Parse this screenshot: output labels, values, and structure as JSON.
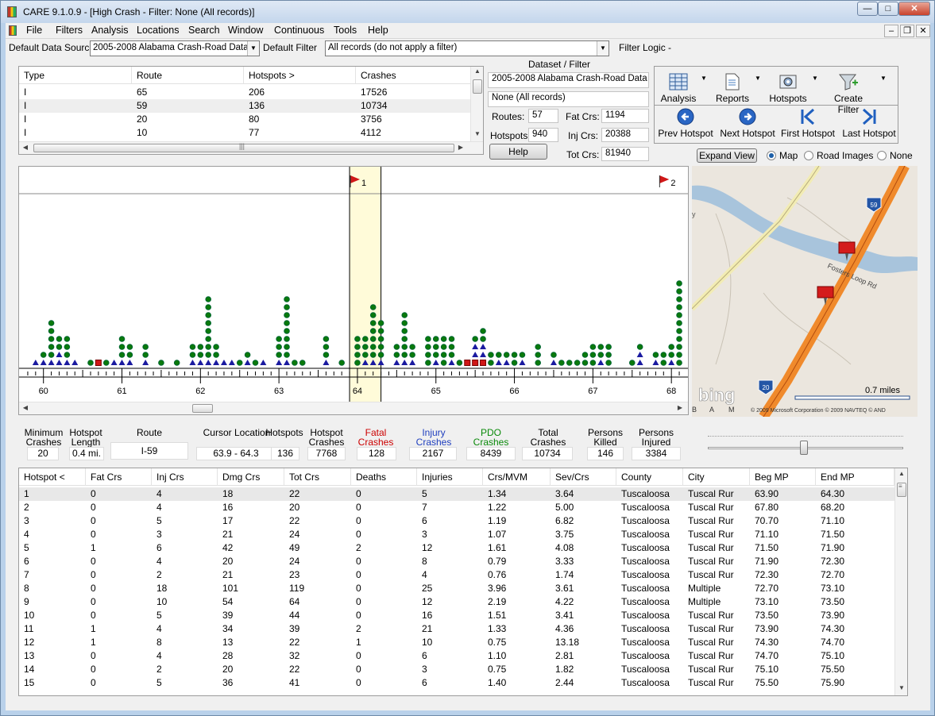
{
  "window": {
    "title": "CARE 9.1.0.9 - [High Crash - Filter:  None (All records)]",
    "min": "—",
    "max": "□",
    "close": "✕"
  },
  "menu": [
    "File",
    "Filters",
    "Analysis",
    "Locations",
    "Search",
    "Window",
    "Continuous",
    "Tools",
    "Help"
  ],
  "mdi_buttons": {
    "min": "‒",
    "restore": "❐",
    "close": "✕"
  },
  "source_bar": {
    "data_source_label": "Default Data Source",
    "data_source_value": "2005-2008 Alabama Crash-Road Data",
    "filter_label": "Default Filter",
    "filter_value": "All records (do not apply a filter)",
    "filter_logic_label": "Filter Logic -"
  },
  "routes_table": {
    "columns": [
      "Type",
      "Route",
      "Hotspots  >",
      "Crashes"
    ],
    "rows": [
      [
        "I",
        "65",
        "206",
        "17526"
      ],
      [
        "I",
        "59",
        "136",
        "10734"
      ],
      [
        "I",
        "20",
        "80",
        "3756"
      ],
      [
        "I",
        "10",
        "77",
        "4112"
      ]
    ]
  },
  "dataset": {
    "header": "Dataset / Filter",
    "dataset_name": "2005-2008 Alabama Crash-Road Data",
    "filter_name": "None (All records)",
    "routes_label": "Routes:",
    "routes_value": "57",
    "hotspots_label": "Hotspots:",
    "hotspots_value": "940",
    "fat_label": "Fat Crs:",
    "fat_value": "1194",
    "inj_label": "Inj Crs:",
    "inj_value": "20388",
    "tot_label": "Tot Crs:",
    "tot_value": "81940",
    "help_label": "Help"
  },
  "toolbar": {
    "tools": [
      "Analysis",
      "Reports",
      "Hotspots",
      "Create Filter"
    ],
    "nav": [
      "Prev Hotspot",
      "Next Hotspot",
      "First Hotspot",
      "Last Hotspot"
    ]
  },
  "map_controls": {
    "expand_label": "Expand View",
    "options": [
      "Map",
      "Road Images",
      "None"
    ],
    "selected": "Map"
  },
  "map": {
    "road_label": "Fosters Loop Rd",
    "shield_59": "59",
    "shield_20": "20",
    "scale_label": "0.7 miles",
    "brand": "bing",
    "copyright": "© 2009 Microsoft Corporation   © 2009 NAVTEQ   © AND",
    "edge_letters": [
      "B",
      "A",
      "M"
    ],
    "left_letter": "y",
    "water_color": "#a8c4dc",
    "road_color": "#f08a2c",
    "bg_color": "#ebe6de"
  },
  "strip": {
    "flags": [
      {
        "label": "1"
      },
      {
        "label": "2"
      }
    ],
    "axis_labels": [
      "60",
      "61",
      "62",
      "63",
      "64",
      "65",
      "66",
      "67",
      "68"
    ],
    "highlight_color": "#fffbd9",
    "legend_colors": {
      "pdo": "#0a7a0a",
      "injury": "#1a1aa0",
      "fatal": "#d01818"
    }
  },
  "chart_data": {
    "type": "scatter",
    "description_units": "milepost",
    "x_range": [
      59.75,
      68.15
    ],
    "highlight": [
      63.9,
      64.3
    ],
    "columns": [
      {
        "mp": 59.9,
        "pdo": 0,
        "inj": 1,
        "fat": 0
      },
      {
        "mp": 60.0,
        "pdo": 1,
        "inj": 1,
        "fat": 0
      },
      {
        "mp": 60.1,
        "pdo": 5,
        "inj": 1,
        "fat": 0
      },
      {
        "mp": 60.2,
        "pdo": 2,
        "inj": 2,
        "fat": 0
      },
      {
        "mp": 60.3,
        "pdo": 3,
        "inj": 1,
        "fat": 0
      },
      {
        "mp": 60.4,
        "pdo": 0,
        "inj": 1,
        "fat": 0
      },
      {
        "mp": 60.6,
        "pdo": 1,
        "inj": 0,
        "fat": 0
      },
      {
        "mp": 60.7,
        "pdo": 0,
        "inj": 0,
        "fat": 1
      },
      {
        "mp": 60.8,
        "pdo": 1,
        "inj": 0,
        "fat": 0
      },
      {
        "mp": 60.9,
        "pdo": 0,
        "inj": 1,
        "fat": 0
      },
      {
        "mp": 61.0,
        "pdo": 3,
        "inj": 1,
        "fat": 0
      },
      {
        "mp": 61.1,
        "pdo": 2,
        "inj": 1,
        "fat": 0
      },
      {
        "mp": 61.3,
        "pdo": 2,
        "inj": 1,
        "fat": 0
      },
      {
        "mp": 61.5,
        "pdo": 1,
        "inj": 0,
        "fat": 0
      },
      {
        "mp": 61.7,
        "pdo": 1,
        "inj": 0,
        "fat": 0
      },
      {
        "mp": 61.9,
        "pdo": 2,
        "inj": 1,
        "fat": 0
      },
      {
        "mp": 62.0,
        "pdo": 2,
        "inj": 1,
        "fat": 0
      },
      {
        "mp": 62.1,
        "pdo": 8,
        "inj": 1,
        "fat": 0
      },
      {
        "mp": 62.2,
        "pdo": 2,
        "inj": 1,
        "fat": 0
      },
      {
        "mp": 62.3,
        "pdo": 0,
        "inj": 1,
        "fat": 0
      },
      {
        "mp": 62.4,
        "pdo": 0,
        "inj": 1,
        "fat": 0
      },
      {
        "mp": 62.5,
        "pdo": 1,
        "inj": 0,
        "fat": 0
      },
      {
        "mp": 62.6,
        "pdo": 1,
        "inj": 1,
        "fat": 0
      },
      {
        "mp": 62.7,
        "pdo": 1,
        "inj": 0,
        "fat": 0
      },
      {
        "mp": 62.8,
        "pdo": 0,
        "inj": 1,
        "fat": 0
      },
      {
        "mp": 63.0,
        "pdo": 3,
        "inj": 1,
        "fat": 0
      },
      {
        "mp": 63.1,
        "pdo": 8,
        "inj": 1,
        "fat": 0
      },
      {
        "mp": 63.2,
        "pdo": 1,
        "inj": 0,
        "fat": 0
      },
      {
        "mp": 63.3,
        "pdo": 1,
        "inj": 0,
        "fat": 0
      },
      {
        "mp": 63.6,
        "pdo": 3,
        "inj": 1,
        "fat": 0
      },
      {
        "mp": 63.8,
        "pdo": 1,
        "inj": 0,
        "fat": 0
      },
      {
        "mp": 64.0,
        "pdo": 4,
        "inj": 0,
        "fat": 0
      },
      {
        "mp": 64.1,
        "pdo": 3,
        "inj": 1,
        "fat": 0
      },
      {
        "mp": 64.2,
        "pdo": 7,
        "inj": 1,
        "fat": 0
      },
      {
        "mp": 64.3,
        "pdo": 5,
        "inj": 1,
        "fat": 0
      },
      {
        "mp": 64.5,
        "pdo": 2,
        "inj": 1,
        "fat": 0
      },
      {
        "mp": 64.6,
        "pdo": 6,
        "inj": 1,
        "fat": 0
      },
      {
        "mp": 64.7,
        "pdo": 2,
        "inj": 1,
        "fat": 0
      },
      {
        "mp": 64.9,
        "pdo": 4,
        "inj": 0,
        "fat": 0
      },
      {
        "mp": 65.0,
        "pdo": 3,
        "inj": 1,
        "fat": 0
      },
      {
        "mp": 65.1,
        "pdo": 4,
        "inj": 0,
        "fat": 0
      },
      {
        "mp": 65.2,
        "pdo": 3,
        "inj": 1,
        "fat": 0
      },
      {
        "mp": 65.3,
        "pdo": 1,
        "inj": 0,
        "fat": 0
      },
      {
        "mp": 65.4,
        "pdo": 0,
        "inj": 0,
        "fat": 1
      },
      {
        "mp": 65.5,
        "pdo": 1,
        "inj": 2,
        "fat": 1
      },
      {
        "mp": 65.6,
        "pdo": 2,
        "inj": 2,
        "fat": 1
      },
      {
        "mp": 65.7,
        "pdo": 2,
        "inj": 0,
        "fat": 0
      },
      {
        "mp": 65.8,
        "pdo": 1,
        "inj": 1,
        "fat": 0
      },
      {
        "mp": 65.9,
        "pdo": 1,
        "inj": 1,
        "fat": 0
      },
      {
        "mp": 66.0,
        "pdo": 2,
        "inj": 0,
        "fat": 0
      },
      {
        "mp": 66.1,
        "pdo": 1,
        "inj": 1,
        "fat": 0
      },
      {
        "mp": 66.3,
        "pdo": 3,
        "inj": 0,
        "fat": 0
      },
      {
        "mp": 66.5,
        "pdo": 1,
        "inj": 1,
        "fat": 0
      },
      {
        "mp": 66.6,
        "pdo": 1,
        "inj": 0,
        "fat": 0
      },
      {
        "mp": 66.7,
        "pdo": 1,
        "inj": 0,
        "fat": 0
      },
      {
        "mp": 66.8,
        "pdo": 1,
        "inj": 0,
        "fat": 0
      },
      {
        "mp": 66.9,
        "pdo": 2,
        "inj": 0,
        "fat": 0
      },
      {
        "mp": 67.0,
        "pdo": 3,
        "inj": 0,
        "fat": 0
      },
      {
        "mp": 67.1,
        "pdo": 2,
        "inj": 1,
        "fat": 0
      },
      {
        "mp": 67.2,
        "pdo": 3,
        "inj": 0,
        "fat": 0
      },
      {
        "mp": 67.5,
        "pdo": 1,
        "inj": 0,
        "fat": 0
      },
      {
        "mp": 67.6,
        "pdo": 1,
        "inj": 2,
        "fat": 0
      },
      {
        "mp": 67.8,
        "pdo": 1,
        "inj": 1,
        "fat": 0
      },
      {
        "mp": 67.9,
        "pdo": 2,
        "inj": 0,
        "fat": 0
      },
      {
        "mp": 68.0,
        "pdo": 2,
        "inj": 1,
        "fat": 0
      },
      {
        "mp": 68.1,
        "pdo": 11,
        "inj": 0,
        "fat": 0
      }
    ]
  },
  "summary": {
    "headers": [
      "Minimum\nCrashes",
      "Hotspot\nLength",
      "Route",
      "Cursor Location",
      "Hotspots",
      "Hotspot\nCrashes",
      "Fatal\nCrashes",
      "Injury\nCrashes",
      "PDO\nCrashes",
      "Total\nCrashes",
      "Persons\nKilled",
      "Persons\nInjured"
    ],
    "values": [
      "20",
      "0.4 mi.",
      "I-59",
      "63.9 - 64.3",
      "136",
      "7768",
      "128",
      "2167",
      "8439",
      "10734",
      "146",
      "3384"
    ],
    "fatal_color": "#cc0000",
    "injury_color": "#1f3fbf",
    "pdo_color": "#0a8a0a"
  },
  "hotspot_table": {
    "columns": [
      "Hotspot  <",
      "Fat Crs",
      "Inj Crs",
      "Dmg Crs",
      "Tot Crs",
      "Deaths",
      "Injuries",
      "Crs/MVM",
      "Sev/Crs",
      "County",
      "City",
      "Beg MP",
      "End MP"
    ],
    "rows": [
      [
        "1",
        "0",
        "4",
        "18",
        "22",
        "0",
        "5",
        "1.34",
        "3.64",
        "Tuscaloosa",
        "Tuscal Rur",
        "63.90",
        "64.30"
      ],
      [
        "2",
        "0",
        "4",
        "16",
        "20",
        "0",
        "7",
        "1.22",
        "5.00",
        "Tuscaloosa",
        "Tuscal Rur",
        "67.80",
        "68.20"
      ],
      [
        "3",
        "0",
        "5",
        "17",
        "22",
        "0",
        "6",
        "1.19",
        "6.82",
        "Tuscaloosa",
        "Tuscal Rur",
        "70.70",
        "71.10"
      ],
      [
        "4",
        "0",
        "3",
        "21",
        "24",
        "0",
        "3",
        "1.07",
        "3.75",
        "Tuscaloosa",
        "Tuscal Rur",
        "71.10",
        "71.50"
      ],
      [
        "5",
        "1",
        "6",
        "42",
        "49",
        "2",
        "12",
        "1.61",
        "4.08",
        "Tuscaloosa",
        "Tuscal Rur",
        "71.50",
        "71.90"
      ],
      [
        "6",
        "0",
        "4",
        "20",
        "24",
        "0",
        "8",
        "0.79",
        "3.33",
        "Tuscaloosa",
        "Tuscal Rur",
        "71.90",
        "72.30"
      ],
      [
        "7",
        "0",
        "2",
        "21",
        "23",
        "0",
        "4",
        "0.76",
        "1.74",
        "Tuscaloosa",
        "Tuscal Rur",
        "72.30",
        "72.70"
      ],
      [
        "8",
        "0",
        "18",
        "101",
        "119",
        "0",
        "25",
        "3.96",
        "3.61",
        "Tuscaloosa",
        "Multiple",
        "72.70",
        "73.10"
      ],
      [
        "9",
        "0",
        "10",
        "54",
        "64",
        "0",
        "12",
        "2.19",
        "4.22",
        "Tuscaloosa",
        "Multiple",
        "73.10",
        "73.50"
      ],
      [
        "10",
        "0",
        "5",
        "39",
        "44",
        "0",
        "16",
        "1.51",
        "3.41",
        "Tuscaloosa",
        "Tuscal Rur",
        "73.50",
        "73.90"
      ],
      [
        "11",
        "1",
        "4",
        "34",
        "39",
        "2",
        "21",
        "1.33",
        "4.36",
        "Tuscaloosa",
        "Tuscal Rur",
        "73.90",
        "74.30"
      ],
      [
        "12",
        "1",
        "8",
        "13",
        "22",
        "1",
        "10",
        "0.75",
        "13.18",
        "Tuscaloosa",
        "Tuscal Rur",
        "74.30",
        "74.70"
      ],
      [
        "13",
        "0",
        "4",
        "28",
        "32",
        "0",
        "6",
        "1.10",
        "2.81",
        "Tuscaloosa",
        "Tuscal Rur",
        "74.70",
        "75.10"
      ],
      [
        "14",
        "0",
        "2",
        "20",
        "22",
        "0",
        "3",
        "0.75",
        "1.82",
        "Tuscaloosa",
        "Tuscal Rur",
        "75.10",
        "75.50"
      ],
      [
        "15",
        "0",
        "5",
        "36",
        "41",
        "0",
        "6",
        "1.40",
        "2.44",
        "Tuscaloosa",
        "Tuscal Rur",
        "75.50",
        "75.90"
      ]
    ]
  }
}
